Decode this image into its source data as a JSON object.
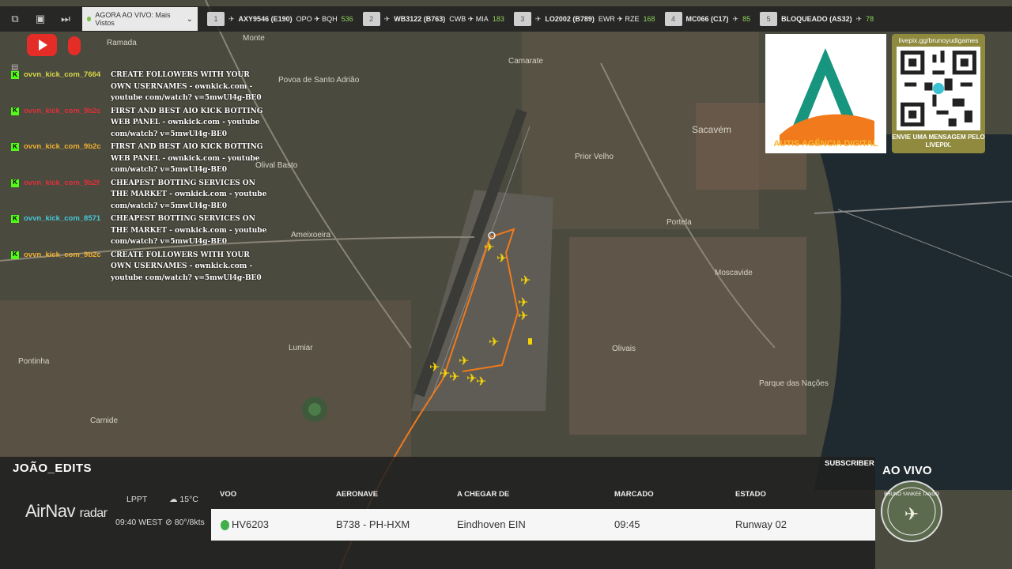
{
  "topbar": {
    "select_value": "AGORA AO VIVO: Mais Vistos",
    "flights": [
      {
        "num": "1",
        "callsign": "AXY9546 (E190)",
        "route": "OPO ✈ BQH",
        "alt": "536"
      },
      {
        "num": "2",
        "callsign": "WB3122 (B763)",
        "route": "CWB ✈ MIA",
        "alt": "183"
      },
      {
        "num": "3",
        "callsign": "LO2002 (B789)",
        "route": "EWR ✈ RZE",
        "alt": "168"
      },
      {
        "num": "4",
        "callsign": "MC066 (C17)",
        "route": "",
        "alt": "85"
      },
      {
        "num": "5",
        "callsign": "BLOQUEADO (AS32)",
        "route": "",
        "alt": "78"
      }
    ]
  },
  "map_labels": [
    "Ramada",
    "Monte",
    "Povoa de Santo Adrião",
    "Camarate",
    "Sacavém",
    "Prior Velho",
    "Olival Basto",
    "Ameixoeira",
    "Portela",
    "Moscavide",
    "Lumiar",
    "Pontinha",
    "Olivais",
    "Carnide",
    "Parque das Nações"
  ],
  "chat": [
    {
      "user": "ovvn_kick_com_7664",
      "color": "#d8d84a",
      "text": "CREATE FOLLOWERS WITH YOUR OWN USERNAMES - ownkick.com - youtube com/watch? v=5mwUl4g-BE0"
    },
    {
      "user": "ovvn_kick_com_9b2c",
      "color": "#e0303a",
      "text": "FIRST AND BEST AIO KICK BOTTING WEB PANEL - ownkick.com - youtube com/watch? v=5mwUl4g-BE0"
    },
    {
      "user": "ovvn_kick_com_9b2c",
      "color": "#f0b030",
      "text": "FIRST AND BEST AIO KICK BOTTING WEB PANEL - ownkick.com - youtube com/watch? v=5mwUl4g-BE0"
    },
    {
      "user": "ovvn_kick_com_9b2f",
      "color": "#e0303a",
      "text": "CHEAPEST BOTTING SERVICES ON THE MARKET - ownkick.com - youtube com/watch? v=5mwUl4g-BE0"
    },
    {
      "user": "ovvn_kick_com_8571",
      "color": "#46c8d8",
      "text": "CHEAPEST BOTTING SERVICES ON THE MARKET - ownkick.com - youtube com/watch? v=5mwUl4g-BE0"
    },
    {
      "user": "ovvn_kick_com_9b2c",
      "color": "#f0b030",
      "text": "CREATE FOLLOWERS WITH YOUR OWN USERNAMES - ownkick.com - youtube com/watch? v=5mwUl4g-BE0"
    }
  ],
  "sponsor": {
    "name": "AUTIS AGÊNCIA DIGITAL"
  },
  "qr": {
    "url": "livepix.gg/brunoyudigames",
    "message": "ENVIE UMA MENSAGEM PELO LIVEPIX."
  },
  "bottom": {
    "channel": "JOÃO_EDITS",
    "subscriber": "SUBSCRIBER",
    "brand": "AirNav",
    "brand_sub": "radar",
    "icao": "LPPT",
    "time": "09:40 WEST",
    "temp": "15°C",
    "wind": "80°/8kts",
    "headers": {
      "flight": "VOO",
      "aircraft": "AERONAVE",
      "from": "A CHEGAR DE",
      "sched": "MARCADO",
      "status": "ESTADO"
    },
    "row": {
      "flight": "HV6203",
      "aircraft": "B738 - PH-HXM",
      "from": "Eindhoven EIN",
      "sched": "09:45",
      "status": "Runway 02"
    },
    "live": "AO VIVO",
    "badge_text": "BRUNO YANKEE TANGO"
  },
  "colors": {
    "route": "#f07a1c",
    "plane": "#f5d20a",
    "kick": "#53fc18"
  }
}
